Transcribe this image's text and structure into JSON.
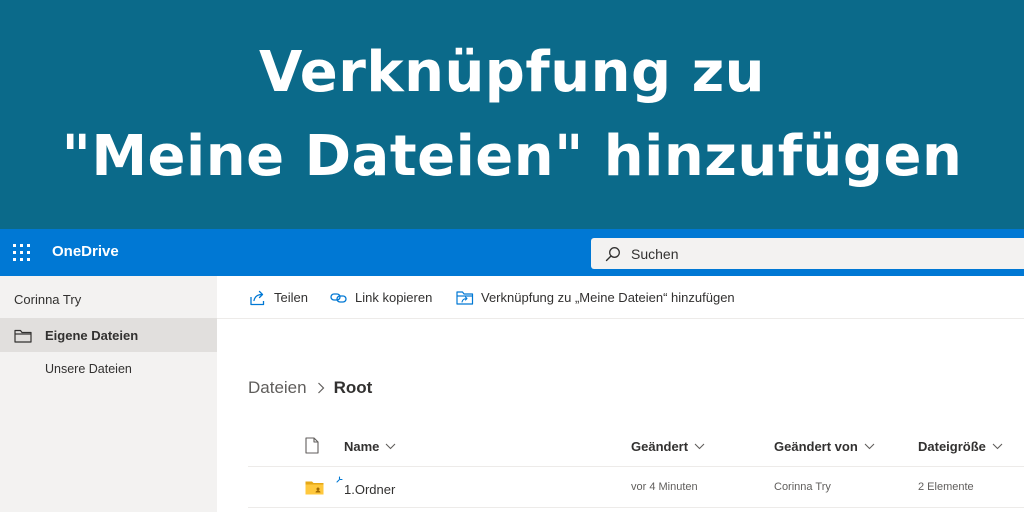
{
  "banner": {
    "line1": "Verknüpfung zu",
    "line2": "\"Meine Dateien\" hinzufügen",
    "background": "#0b6a8a"
  },
  "app_bar": {
    "app_name": "OneDrive",
    "accent": "#0078d4",
    "waffle_icon": "app-launcher-icon"
  },
  "search": {
    "placeholder": "Suchen",
    "icon": "search-icon"
  },
  "sidebar": {
    "user_name": "Corinna Try",
    "items": [
      {
        "label": "Eigene Dateien",
        "active": true,
        "icon": "folder-icon"
      },
      {
        "label": "Unsere Dateien",
        "active": false
      }
    ]
  },
  "command_bar": {
    "share": "Teilen",
    "copy_link": "Link kopieren",
    "add_shortcut": "Verknüpfung zu „Meine Dateien“ hinzufügen"
  },
  "breadcrumb": {
    "items": [
      "Dateien",
      "Root"
    ]
  },
  "list": {
    "columns": {
      "name": "Name",
      "modified": "Geändert",
      "modified_by": "Geändert von",
      "size": "Dateigröße"
    },
    "rows": [
      {
        "name": "1.Ordner",
        "modified": "vor 4 Minuten",
        "modified_by": "Corinna Try",
        "size": "2 Elemente",
        "icon": "shared-folder-icon"
      }
    ]
  }
}
